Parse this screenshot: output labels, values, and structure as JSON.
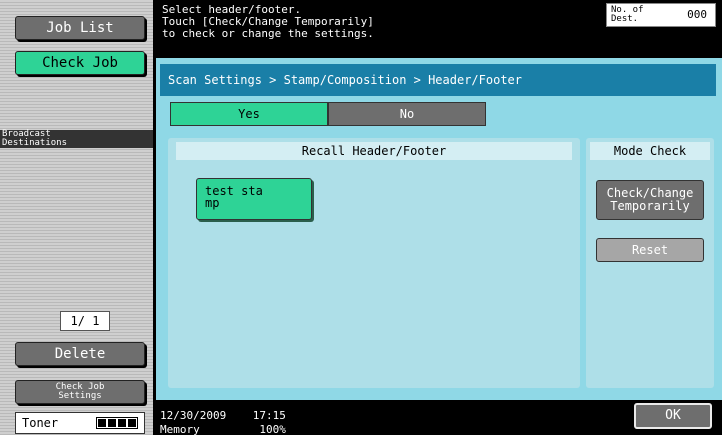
{
  "left_panel": {
    "job_list": "Job List",
    "check_job": "Check Job",
    "broadcast_destinations": "Broadcast\nDestinations",
    "pager": "1/ 1",
    "delete": "Delete",
    "check_job_settings": "Check Job\nSettings",
    "toner_label": "Toner"
  },
  "message": {
    "line1": "Select header/footer.",
    "line2": "Touch [Check/Change Temporarily]",
    "line3": "to check or change the settings.",
    "counter_label": "No. of\nDest.",
    "counter_value": "000"
  },
  "breadcrumb": "Scan Settings > Stamp/Composition > Header/Footer",
  "toggle": {
    "yes": "Yes",
    "no": "No"
  },
  "recall": {
    "title": "Recall Header/Footer",
    "slot": "test sta\nmp"
  },
  "mode_check": {
    "title": "Mode Check",
    "change": "Check/Change\nTemporarily",
    "reset": "Reset"
  },
  "status": {
    "datetime": "12/30/2009    17:15",
    "memory": "Memory         100%",
    "ok": "OK"
  },
  "colors": {
    "accent_green": "#2ed396",
    "header_blue": "#1a7fa7",
    "panel_cyan": "#8fd8e6"
  }
}
